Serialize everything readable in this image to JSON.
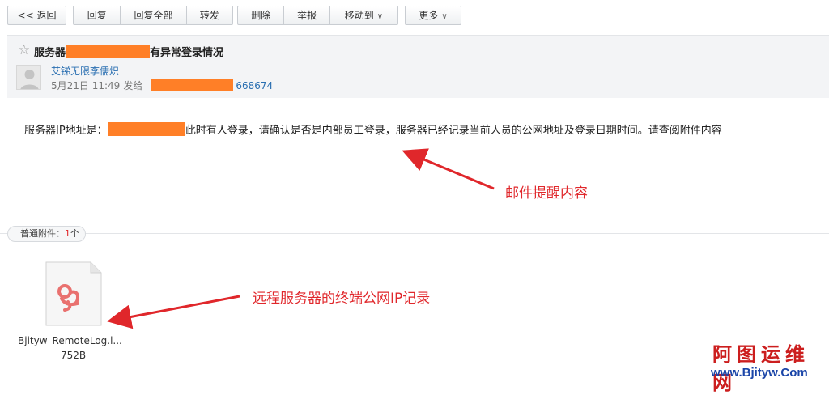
{
  "toolbar": {
    "back": "<< 返回",
    "reply": "回复",
    "reply_all": "回复全部",
    "forward": "转发",
    "delete": "删除",
    "report": "举报",
    "move_to": "移动到",
    "more": "更多"
  },
  "header": {
    "subject_prefix": "服务器",
    "subject_suffix": "有异常登录情况",
    "sender": "艾锑无限李儒炽",
    "date": "5月21日 11:49",
    "sent_to_label": "发给",
    "recipient_suffix": "668674"
  },
  "body": {
    "text_prefix": "服务器IP地址是：",
    "text_suffix": "此时有人登录，请确认是否是内部员工登录，服务器已经记录当前人员的公网地址及登录日期时间。请查阅附件内容"
  },
  "annotations": {
    "content_note": "邮件提醒内容",
    "attachment_note": "远程服务器的终端公网IP记录"
  },
  "attachments": {
    "label": "普通附件：",
    "count": "1",
    "count_unit": "个",
    "file_name": "Bjityw_RemoteLog.l...",
    "file_size": "752B"
  },
  "watermark": {
    "title": "阿图运维网",
    "url": "www.Bjityw.Com"
  },
  "colors": {
    "redaction": "#ff7f27",
    "annotation": "#e0272b",
    "link": "#2a6fb1"
  }
}
